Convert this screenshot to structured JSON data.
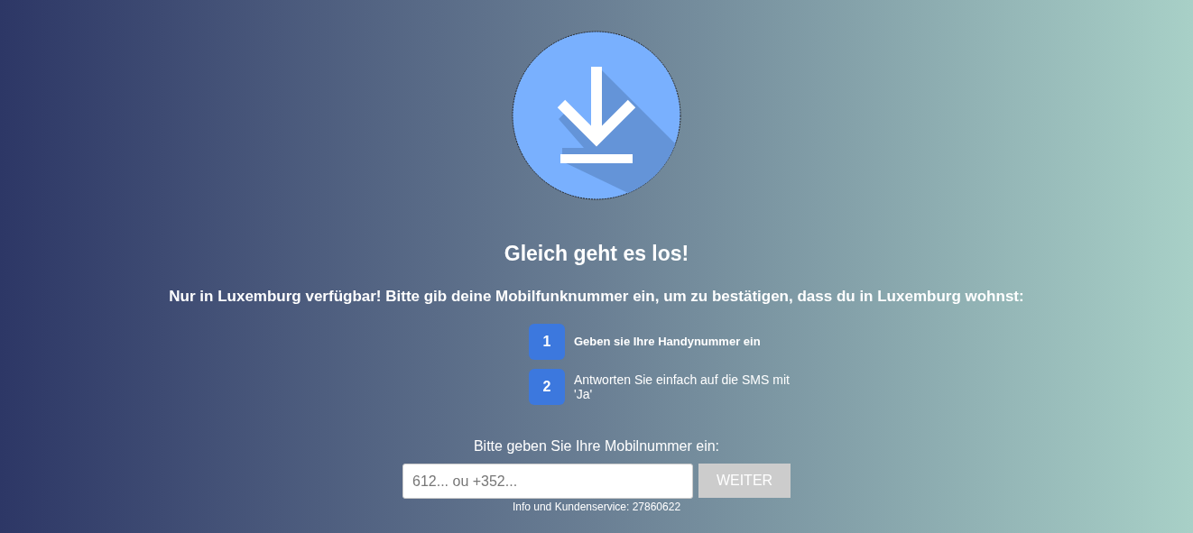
{
  "title": "Gleich geht es los!",
  "subtitle": "Nur in Luxemburg verfügbar! Bitte gib deine Mobilfunknummer ein, um zu bestätigen, dass du in Luxemburg wohnst:",
  "steps": [
    {
      "number": "1",
      "text": "Geben sie Ihre Handynummer ein",
      "selected": true
    },
    {
      "number": "2",
      "text": "Antworten Sie einfach auf die SMS mit 'Ja'",
      "selected": false
    }
  ],
  "form": {
    "label": "Bitte geben Sie Ihre Mobilnummer ein:",
    "placeholder": "612... ou +352...",
    "button": "WEITER",
    "button_disabled": true
  },
  "footer": "Info und Kundenservice: 27860622"
}
